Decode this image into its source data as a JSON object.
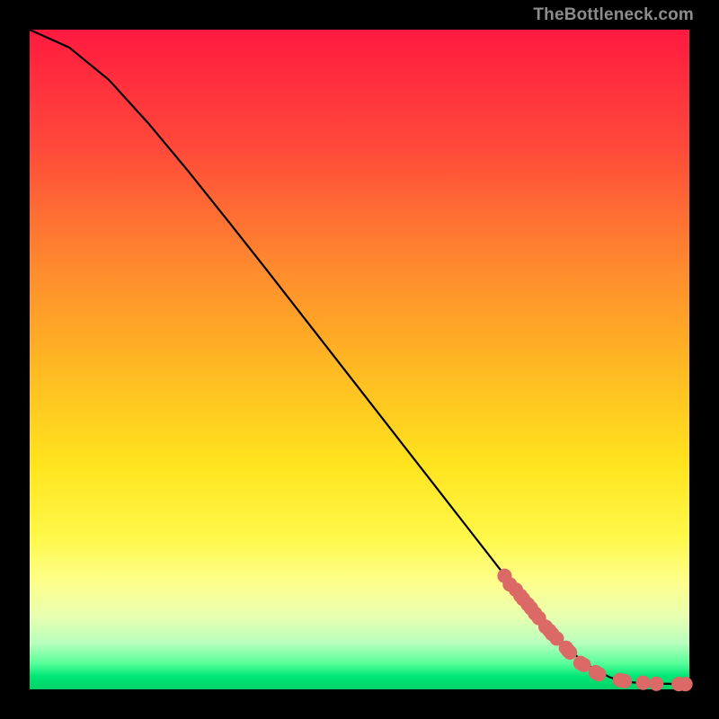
{
  "watermark": "TheBottleneck.com",
  "chart_data": {
    "type": "line",
    "title": "",
    "xlabel": "",
    "ylabel": "",
    "xlim": [
      0,
      100
    ],
    "ylim": [
      0,
      100
    ],
    "curve": {
      "x": [
        0,
        6,
        12,
        18,
        24,
        30,
        36,
        42,
        48,
        54,
        60,
        66,
        72,
        78,
        84,
        88,
        90,
        92,
        94,
        96,
        98,
        100
      ],
      "y": [
        100,
        97.3,
        92.4,
        85.8,
        78.6,
        71.1,
        63.5,
        55.8,
        48.1,
        40.4,
        32.7,
        25.0,
        17.3,
        9.8,
        4.0,
        1.8,
        1.2,
        1.0,
        0.9,
        0.85,
        0.82,
        0.8
      ]
    },
    "markers": {
      "x": [
        72.0,
        72.8,
        73.7,
        74.4,
        74.8,
        75.5,
        76.0,
        76.6,
        77.2,
        78.2,
        78.8,
        79.2,
        79.9,
        81.3,
        81.6,
        81.9,
        83.5,
        84.0,
        85.8,
        86.3,
        89.5,
        90.2,
        93.0,
        95.0,
        98.4,
        99.4
      ],
      "y": [
        17.2,
        15.9,
        15.1,
        14.2,
        13.7,
        12.9,
        12.3,
        11.5,
        10.8,
        9.5,
        8.9,
        8.4,
        7.7,
        6.3,
        5.9,
        5.6,
        4.0,
        3.7,
        2.6,
        2.3,
        1.4,
        1.25,
        1.0,
        0.85,
        0.8,
        0.8
      ]
    },
    "marker_radius": 1.1,
    "gradient_description": "vertical rainbow red→yellow→green"
  }
}
